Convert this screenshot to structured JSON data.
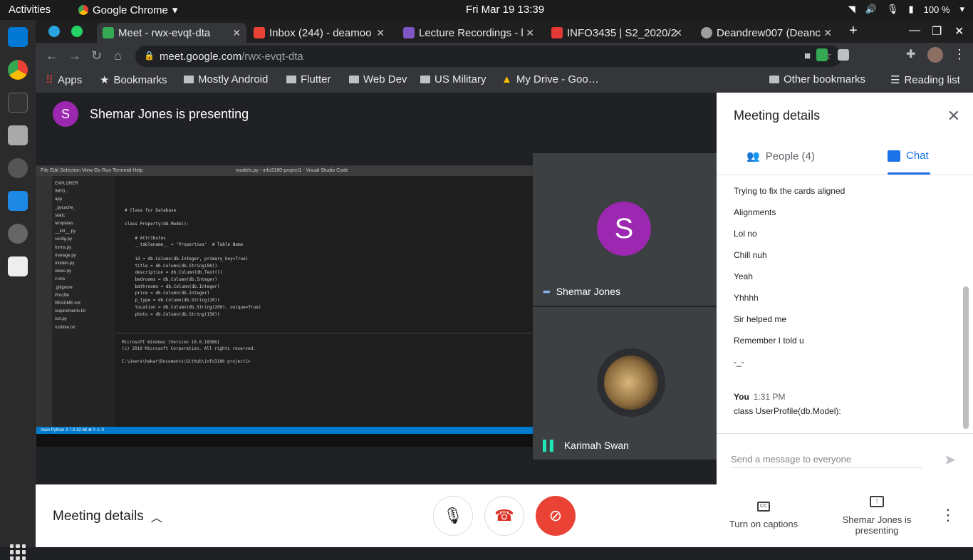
{
  "os": {
    "activities": "Activities",
    "app": "Google Chrome",
    "clock": "Fri Mar 19  13:39",
    "battery": "100 %"
  },
  "tabs": [
    {
      "label": "Meet - rwx-evqt-dta",
      "color": "#34a853"
    },
    {
      "label": "Inbox (244) - deamoo",
      "color": "#ea4335"
    },
    {
      "label": "Lecture Recordings - l",
      "color": "#7e57c2"
    },
    {
      "label": "INFO3435 | S2_2020/2",
      "color": "#e53935"
    },
    {
      "label": "Deandrew007 (Deanc",
      "color": "#9e9e9e"
    }
  ],
  "address": {
    "host": "meet.google.com",
    "path": "/rwx-evqt-dta"
  },
  "bookmarks": {
    "apps": "Apps",
    "items": [
      "Bookmarks",
      "Mostly Android",
      "Flutter",
      "Web Dev",
      "US Military",
      "My Drive - Goo…"
    ],
    "other": "Other bookmarks",
    "reading": "Reading list"
  },
  "meet": {
    "presenter_initial": "S",
    "presenter_text": "Shemar Jones is presenting"
  },
  "shared_screen": {
    "title": "models.py - info3180-project1 - Visual Studio Code",
    "menu": "File  Edit  Selection  View  Go  Run  Terminal  Help",
    "explorer": [
      "EXPLORER",
      "INFO...",
      "app",
      "_pycache_",
      "static",
      "templates",
      "__init__.py",
      "config.py",
      "forms.py",
      "manage.py",
      "models.py",
      "views.py",
      "v-env",
      ".gitignore",
      "Procfile",
      "README.md",
      "requirements.txt",
      "run.py",
      "runtime.txt"
    ],
    "code": [
      "# Class for Database",
      "",
      "class Property(db.Model):",
      "",
      "    # Attributes",
      "    __tablename__ = 'Properties'  # Table Name",
      "",
      "    id = db.Column(db.Integer, primary_key=True)",
      "    title = db.Column(db.String(80))",
      "    description = db.Column(db.Text())",
      "    bedrooms = db.Column(db.Integer)",
      "    bathrooms = db.Column(db.Integer)",
      "    price = db.Column(db.Integer)",
      "    p_type = db.Column(db.String(20))",
      "    location = db.Column(db.String(200), unique=True)",
      "    photo = db.Column(db.String(150))"
    ],
    "terminal": [
      "Microsoft Windows [Version 10.0.18586]",
      "(c) 2019 Microsoft Corporation. All rights reserved.",
      "",
      "C:\\Users\\hakar\\Documents\\GitHub\\info3180 project1>"
    ],
    "status": "main   Python 3.7.0 32-bit   ⊗ 0 ⚠ 0"
  },
  "participants": [
    {
      "initial": "S",
      "name": "Shemar Jones"
    },
    {
      "name": "Karimah Swan"
    }
  ],
  "panel": {
    "title": "Meeting details",
    "people_tab": "People (4)",
    "chat_tab": "Chat",
    "messages": [
      "Trying to fix the cards aligned",
      "Alignments",
      "Lol no",
      "Chill nuh",
      "Yeah",
      "Yhhhh",
      "Sir helped me",
      "Remember I told u",
      "-_-"
    ],
    "you": {
      "author": "You",
      "time": "1:31 PM",
      "text": "class UserProfile(db.Model):"
    },
    "send_placeholder": "Send a message to everyone"
  },
  "bottom": {
    "meeting_details": "Meeting details",
    "captions": "Turn on captions",
    "presenting": "Shemar Jones is presenting"
  }
}
